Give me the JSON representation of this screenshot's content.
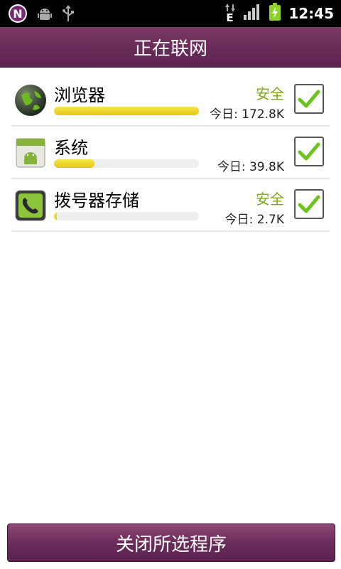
{
  "status_bar": {
    "time": "12:45",
    "network_type": "E",
    "icons": [
      "netqin-icon",
      "android-debug-icon",
      "usb-icon",
      "data-arrows-icon",
      "signal-icon",
      "battery-charging-icon"
    ]
  },
  "header": {
    "title": "正在联网"
  },
  "apps": [
    {
      "name": "浏览器",
      "status": "安全",
      "usage": "今日: 172.8K",
      "usage_fraction": 1.0,
      "checked": true,
      "icon": "globe-icon"
    },
    {
      "name": "系统",
      "status": "",
      "usage": "今日: 39.8K",
      "usage_fraction": 0.28,
      "checked": true,
      "icon": "android-system-icon"
    },
    {
      "name": "拨号器存储",
      "status": "安全",
      "usage": "今日: 2.7K",
      "usage_fraction": 0.02,
      "checked": true,
      "icon": "phone-icon"
    }
  ],
  "footer": {
    "close_button": "关闭所选程序"
  },
  "colors": {
    "accent": "#6b2c5a",
    "safe": "#7da619",
    "bar": "#e8cf1c",
    "check": "#6bc41d"
  }
}
